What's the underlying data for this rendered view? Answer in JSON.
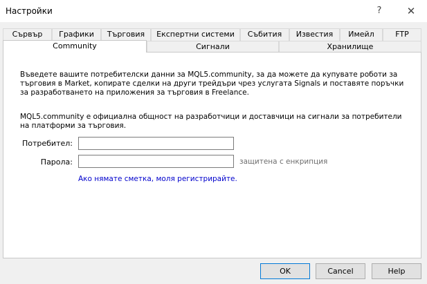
{
  "window": {
    "title": "Настройки",
    "help_glyph": "?",
    "close_glyph": "✕"
  },
  "tabs_row1": [
    "Сървър",
    "Графики",
    "Търговия",
    "Експертни системи",
    "Събития",
    "Известия",
    "Имейл",
    "FTP"
  ],
  "tabs_row2": [
    "Community",
    "Сигнали",
    "Хранилище"
  ],
  "active_tab": "Community",
  "content": {
    "paragraph1": "Въведете вашите потребителски данни за MQL5.community, за да можете да купувате роботи за търговия в Market, копирате сделки на други трейдъри чрез услугата Signals  и поставяте поръчки за разработването на приложения за търговия в Freelance.",
    "paragraph2": "MQL5.community е официална общност на разработчици и доставчици на сигнали за потребители на платформи за търговия.",
    "user_label": "Потребител:",
    "user_value": "",
    "password_label": "Парола:",
    "password_value": "",
    "encryption_note": "защитена с енкрипция",
    "register_link": "Ако нямате сметка, моля регистрирайте."
  },
  "buttons": {
    "ok": "OK",
    "cancel": "Cancel",
    "help": "Help"
  },
  "colors": {
    "link": "#0000cc",
    "default_button_border": "#0078d7"
  }
}
